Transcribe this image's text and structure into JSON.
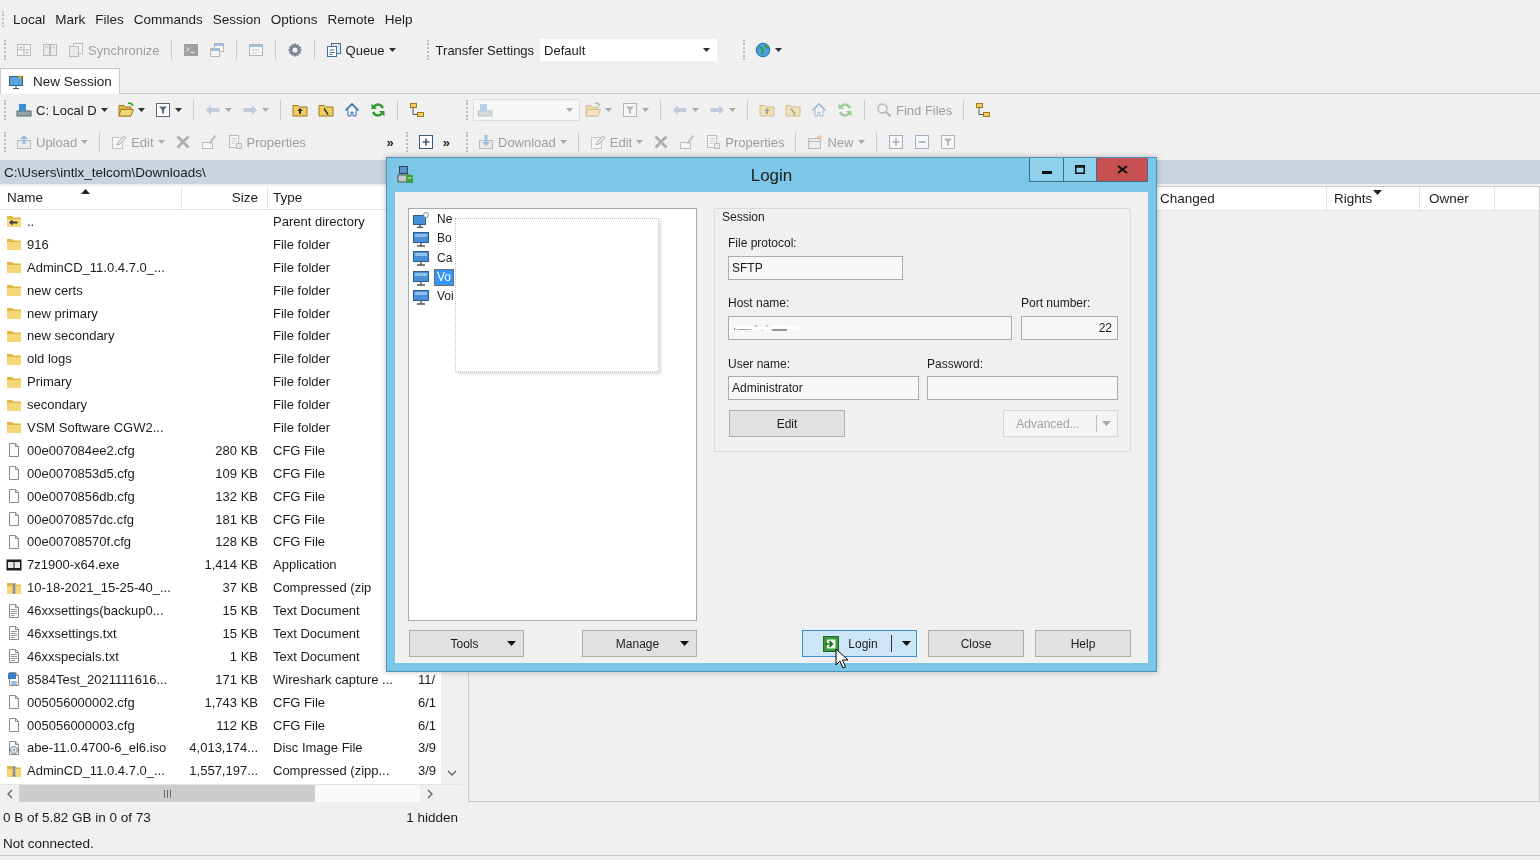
{
  "menu_bar": {
    "items": [
      "Local",
      "Mark",
      "Files",
      "Commands",
      "Session",
      "Options",
      "Remote",
      "Help"
    ]
  },
  "main_toolbar": {
    "bands": [
      [
        [
          {
            "kind": "button",
            "disabled": true,
            "dropdown": false
          },
          {
            "kind": "button",
            "disabled": true,
            "dropdown": false
          },
          {
            "kind": "button",
            "label": "Synchronize",
            "disabled": true,
            "dropdown": false
          }
        ],
        [
          {
            "kind": "button",
            "disabled": true,
            "dropdown": false
          },
          {
            "kind": "button",
            "disabled": true,
            "dropdown": false
          }
        ],
        [
          {
            "kind": "button",
            "disabled": true,
            "dropdown": false
          }
        ],
        [
          {
            "kind": "button",
            "disabled": false,
            "dropdown": false
          }
        ],
        [
          {
            "kind": "button",
            "label": "Queue",
            "disabled": false,
            "dropdown": true
          }
        ]
      ],
      [
        [
          {
            "kind": "combo",
            "label": "Transfer Settings",
            "value": "Default",
            "disabled": false,
            "dropdown": true
          }
        ]
      ],
      [
        [
          {
            "kind": "button",
            "disabled": false,
            "dropdown": true
          }
        ]
      ]
    ]
  },
  "session_tabs": [
    {
      "label": "New Session",
      "selected": true
    }
  ],
  "local_panel": {
    "navigation_toolbar": {
      "bands": [
        [
          [
            {
              "kind": "button",
              "label": "C: Local D",
              "disabled": false,
              "dropdown": true
            },
            {
              "kind": "button",
              "disabled": false,
              "dropdown": true
            },
            {
              "kind": "button",
              "disabled": false,
              "dropdown": true
            }
          ],
          [
            {
              "kind": "button",
              "disabled": true,
              "dropdown": true
            },
            {
              "kind": "button",
              "disabled": true,
              "dropdown": true
            }
          ],
          [
            {
              "kind": "button",
              "disabled": false,
              "dropdown": false
            },
            {
              "kind": "button",
              "disabled": false,
              "dropdown": false
            },
            {
              "kind": "button",
              "disabled": false,
              "dropdown": false
            },
            {
              "kind": "button",
              "disabled": false,
              "dropdown": false
            }
          ],
          [
            {
              "kind": "button",
              "disabled": false,
              "dropdown": false
            }
          ]
        ]
      ]
    },
    "command_toolbar": {
      "bands": [
        [
          [
            {
              "kind": "button",
              "label": "Upload",
              "disabled": true,
              "dropdown": true
            }
          ],
          [
            {
              "kind": "button",
              "label": "Edit",
              "disabled": true,
              "dropdown": true
            },
            {
              "kind": "button",
              "disabled": true,
              "dropdown": false
            },
            {
              "kind": "button",
              "disabled": true,
              "dropdown": false
            },
            {
              "kind": "button",
              "label": "Properties",
              "disabled": true,
              "dropdown": false
            },
            {
              "kind": "overflow",
              "label": "»",
              "disabled": false,
              "dropdown": false
            }
          ]
        ],
        [
          [
            {
              "kind": "button",
              "disabled": false,
              "dropdown": false
            },
            {
              "kind": "overflow",
              "label": "»",
              "disabled": false,
              "dropdown": false
            }
          ]
        ]
      ]
    },
    "path": "C:\\Users\\intlx_telcom\\Downloads\\",
    "columns": [
      {
        "label": "Name",
        "sorted": true,
        "descending": false
      },
      {
        "label": "Size",
        "sorted": false
      },
      {
        "label": "Type",
        "sorted": false
      }
    ],
    "rows": [
      {
        "kind": "parent",
        "name": "..",
        "type": "Parent directory"
      },
      {
        "kind": "folder",
        "name": "916",
        "type": "File folder"
      },
      {
        "kind": "folder",
        "name": "AdminCD_11.0.4.7.0_...",
        "type": "File folder"
      },
      {
        "kind": "folder",
        "name": "new certs",
        "type": "File folder"
      },
      {
        "kind": "folder",
        "name": "new primary",
        "type": "File folder"
      },
      {
        "kind": "folder",
        "name": "new secondary",
        "type": "File folder"
      },
      {
        "kind": "folder",
        "name": "old logs",
        "type": "File folder"
      },
      {
        "kind": "folder",
        "name": "Primary",
        "type": "File folder"
      },
      {
        "kind": "folder",
        "name": "secondary",
        "type": "File folder"
      },
      {
        "kind": "folder",
        "name": "VSM Software CGW2...",
        "type": "File folder"
      },
      {
        "kind": "file",
        "name": "00e007084ee2.cfg",
        "size": "280 KB",
        "type": "CFG File"
      },
      {
        "kind": "file",
        "name": "00e0070853d5.cfg",
        "size": "109 KB",
        "type": "CFG File"
      },
      {
        "kind": "file",
        "name": "00e0070856db.cfg",
        "size": "132 KB",
        "type": "CFG File"
      },
      {
        "kind": "file",
        "name": "00e0070857dc.cfg",
        "size": "181 KB",
        "type": "CFG File"
      },
      {
        "kind": "file",
        "name": "00e00708570f.cfg",
        "size": "128 KB",
        "type": "CFG File"
      },
      {
        "kind": "application",
        "name": "7z1900-x64.exe",
        "size": "1,414 KB",
        "type": "Application"
      },
      {
        "kind": "archive",
        "name": "10-18-2021_15-25-40_...",
        "size": "37 KB",
        "type": "Compressed (zip"
      },
      {
        "kind": "text",
        "name": "46xxsettings(backup0...",
        "size": "15 KB",
        "type": "Text Document"
      },
      {
        "kind": "text",
        "name": "46xxsettings.txt",
        "size": "15 KB",
        "type": "Text Document"
      },
      {
        "kind": "text",
        "name": "46xxspecials.txt",
        "size": "1 KB",
        "type": "Text Document"
      },
      {
        "kind": "capture",
        "name": "8584Test_2021111616...",
        "size": "171 KB",
        "type": "Wireshark capture ...",
        "column_4": "11/"
      },
      {
        "kind": "file",
        "name": "005056000002.cfg",
        "size": "1,743 KB",
        "type": "CFG File",
        "column_4": "6/1"
      },
      {
        "kind": "file",
        "name": "005056000003.cfg",
        "size": "112 KB",
        "type": "CFG File",
        "column_4": "6/1"
      },
      {
        "kind": "disc",
        "name": "abe-11.0.4700-6_el6.iso",
        "size": "4,013,174...",
        "type": "Disc Image File",
        "column_4": "3/9"
      },
      {
        "kind": "archive",
        "name": "AdminCD_11.0.4.7.0_...",
        "size": "1,557,197...",
        "type": "Compressed (zipp...",
        "column_4": "3/9"
      }
    ]
  },
  "remote_panel": {
    "navigation_toolbar": {
      "bands": [
        [
          [
            {
              "kind": "combo",
              "disabled": true,
              "dropdown": true
            },
            {
              "kind": "button",
              "disabled": true,
              "dropdown": true
            },
            {
              "kind": "button",
              "disabled": true,
              "dropdown": true
            }
          ],
          [
            {
              "kind": "button",
              "disabled": true,
              "dropdown": true
            },
            {
              "kind": "button",
              "disabled": true,
              "dropdown": true
            }
          ],
          [
            {
              "kind": "button",
              "disabled": true,
              "dropdown": false
            },
            {
              "kind": "button",
              "disabled": true,
              "dropdown": false
            },
            {
              "kind": "button",
              "disabled": true,
              "dropdown": false
            },
            {
              "kind": "button",
              "disabled": true,
              "dropdown": false
            }
          ],
          [
            {
              "kind": "button",
              "label": "Find Files",
              "disabled": true,
              "dropdown": false
            }
          ],
          [
            {
              "kind": "button",
              "disabled": false,
              "dropdown": false
            }
          ]
        ]
      ]
    },
    "command_toolbar": {
      "bands": [
        [
          [
            {
              "kind": "button",
              "label": "Download",
              "disabled": true,
              "dropdown": true
            }
          ],
          [
            {
              "kind": "button",
              "label": "Edit",
              "disabled": true,
              "dropdown": true
            },
            {
              "kind": "button",
              "disabled": true,
              "dropdown": false
            },
            {
              "kind": "button",
              "disabled": true,
              "dropdown": false
            },
            {
              "kind": "button",
              "label": "Properties",
              "disabled": true,
              "dropdown": false
            }
          ],
          [
            {
              "kind": "button",
              "label": "New",
              "disabled": true,
              "dropdown": true
            }
          ],
          [
            {
              "kind": "button",
              "disabled": true,
              "dropdown": false
            },
            {
              "kind": "button",
              "disabled": true,
              "dropdown": false
            },
            {
              "kind": "button",
              "disabled": true,
              "dropdown": false
            }
          ]
        ]
      ]
    },
    "columns": [
      {
        "label": "Changed",
        "sorted": false
      },
      {
        "label": "Rights",
        "sorted": true,
        "descending": true
      },
      {
        "label": "Owner",
        "sorted": false
      }
    ]
  },
  "status_bar": {
    "selection": "0 B of 5.82 GB in 0 of 73",
    "hidden": "1 hidden",
    "connection": "Not connected."
  },
  "login_dialog": {
    "title": "Login",
    "sites": [
      {
        "label": "Ne",
        "kind": "new",
        "selected": false
      },
      {
        "label": "Bo",
        "kind": "site",
        "selected": false
      },
      {
        "label": "Ca",
        "kind": "site",
        "selected": false
      },
      {
        "label": "Vo",
        "kind": "site",
        "selected": true
      },
      {
        "label": "Voi",
        "kind": "site",
        "selected": false
      }
    ],
    "session": {
      "title": "Session",
      "file_protocol": {
        "label": "File protocol:",
        "value": "SFTP"
      },
      "host_name": {
        "label": "Host name:",
        "redacted": true
      },
      "port_number": {
        "label": "Port number:",
        "value": "22"
      },
      "user_name": {
        "label": "User name:",
        "value": "Administrator"
      },
      "password": {
        "label": "Password:"
      },
      "edit_button": {
        "label": "Edit",
        "disabled": false
      },
      "advanced_button": {
        "label": "Advanced...",
        "disabled": true,
        "dropdown": true
      }
    },
    "tree_buttons": [
      {
        "label": "Tools",
        "dropdown": true
      },
      {
        "label": "Manage",
        "dropdown": true
      }
    ],
    "action_buttons": [
      {
        "label": "Login",
        "kind": "split",
        "highlighted": true
      },
      {
        "label": "Close",
        "kind": "plain",
        "highlighted": false
      },
      {
        "label": "Help",
        "kind": "plain",
        "highlighted": false
      }
    ]
  }
}
